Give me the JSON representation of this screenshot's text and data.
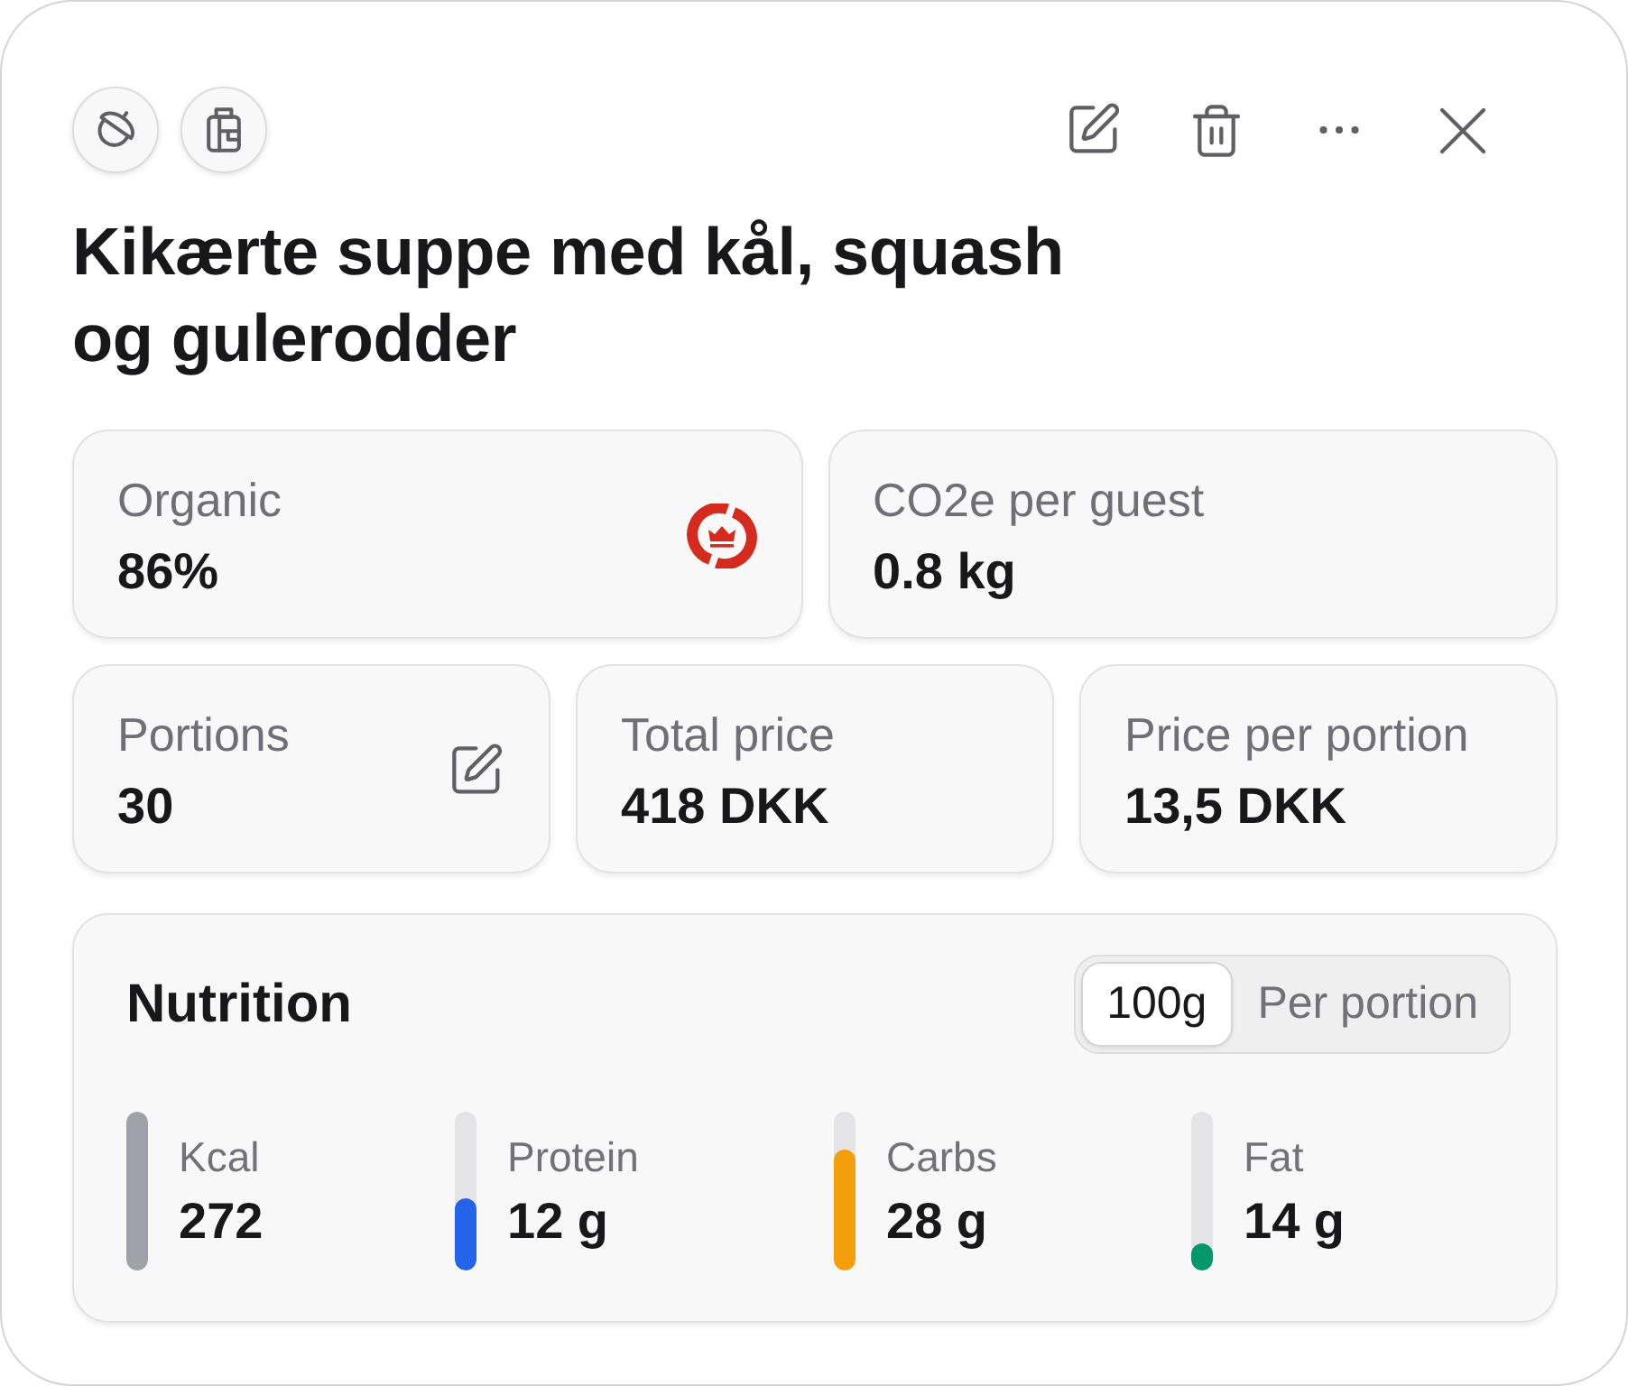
{
  "title": "Kikærte suppe med kål, squash og gulerodder",
  "stat_rows": [
    {
      "cards": [
        {
          "kind": "organic",
          "label": "Organic",
          "value": "86%"
        },
        {
          "kind": "plain",
          "label": "CO2e per guest",
          "value": "0.8 kg"
        }
      ]
    },
    {
      "cards": [
        {
          "kind": "editable",
          "label": "Portions",
          "value": "30"
        },
        {
          "kind": "plain",
          "label": "Total price",
          "value": "418 DKK"
        },
        {
          "kind": "plain",
          "label": "Price per portion",
          "value": "13,5 DKK"
        }
      ]
    }
  ],
  "nutrition": {
    "title": "Nutrition",
    "units": [
      {
        "label": "100g",
        "selected": true
      },
      {
        "label": "Per portion",
        "selected": false
      }
    ],
    "nutrients": [
      {
        "label": "Kcal",
        "value": "272",
        "level": 1,
        "color": "#a1a1aa"
      },
      {
        "label": "Protein",
        "value": "12 g",
        "level": 0.45,
        "color": "#2563eb"
      },
      {
        "label": "Carbs",
        "value": "28 g",
        "level": 0.76,
        "color": "#f59e0b"
      },
      {
        "label": "Fat",
        "value": "14 g",
        "level": 0.17,
        "color": "#059669"
      }
    ]
  }
}
